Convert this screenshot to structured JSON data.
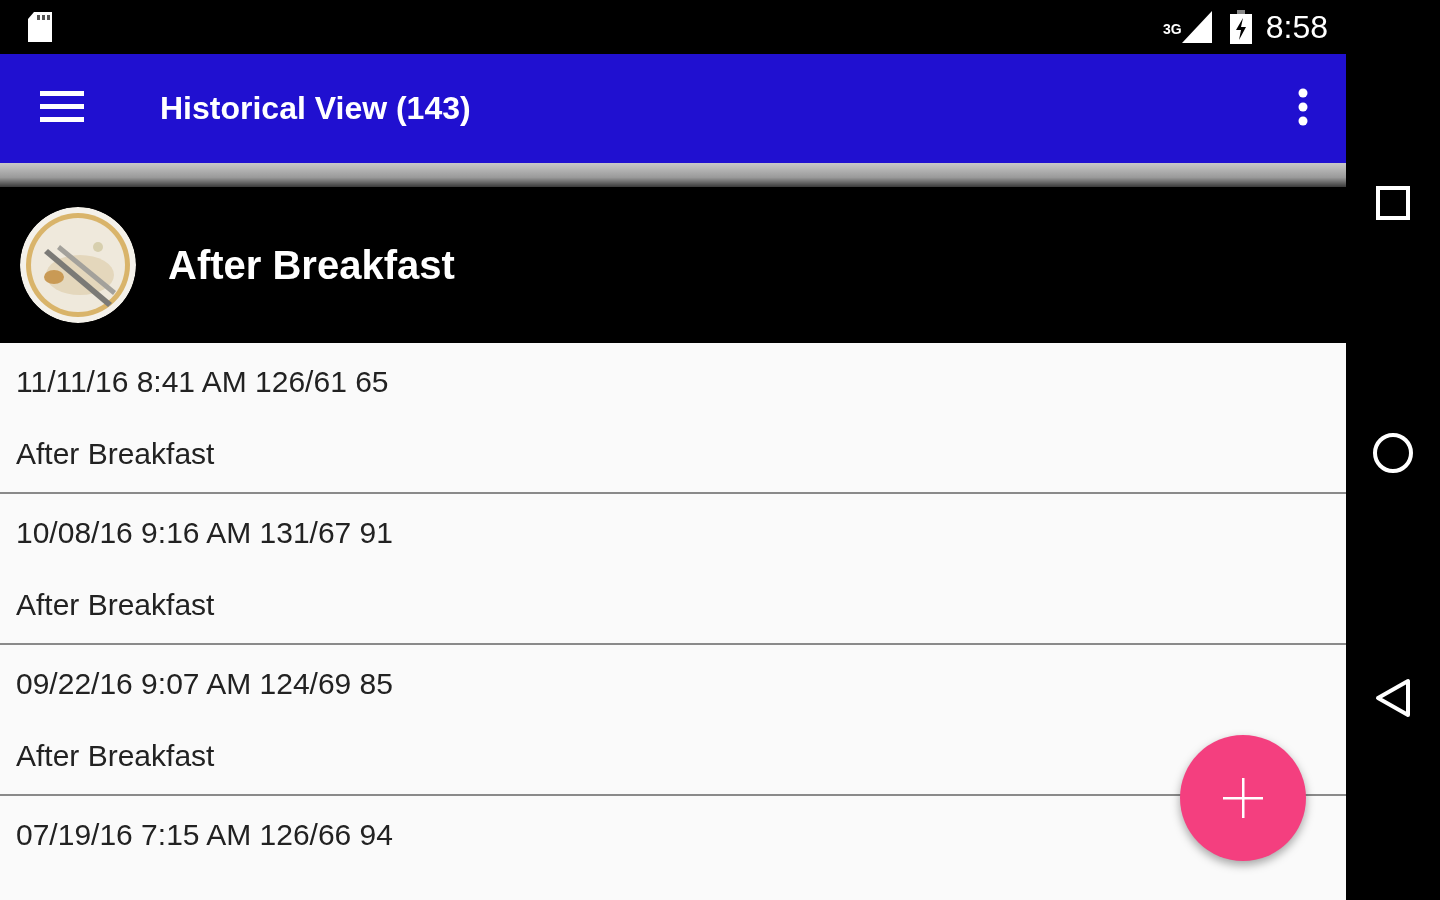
{
  "status_bar": {
    "network": "3G",
    "time": "8:58"
  },
  "app_bar": {
    "title": "Historical View (143)"
  },
  "header": {
    "title": "After Breakfast",
    "kind": "picture"
  },
  "rows": [
    {
      "reading": "11/11/16 8:41 AM 126/61 65",
      "label": "After Breakfast"
    },
    {
      "reading": "10/08/16 9:16 AM 131/67 91",
      "label": "After Breakfast"
    },
    {
      "reading": "09/22/16 9:07 AM 124/69 85",
      "label": "After Breakfast"
    },
    {
      "reading": "07/19/16 7:15 AM 126/66 94"
    }
  ]
}
